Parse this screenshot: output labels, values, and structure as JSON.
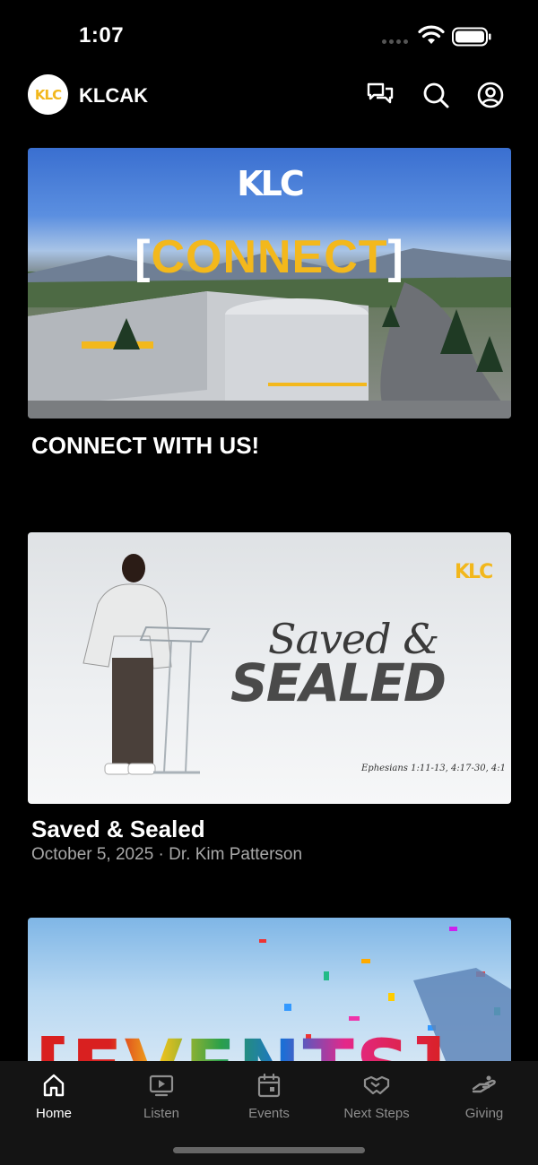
{
  "status": {
    "time": "1:07"
  },
  "header": {
    "logo_text": "KLC",
    "app_name": "KLCAK",
    "icons": [
      "chat-icon",
      "search-icon",
      "profile-icon"
    ]
  },
  "cards": [
    {
      "image": {
        "logo": "KLC",
        "bracket_left": "[",
        "word": "CONNECT",
        "bracket_right": "]"
      },
      "title": "CONNECT WITH US!"
    },
    {
      "image": {
        "logo": "KLC",
        "script": "Saved &",
        "block": "SEALED",
        "reference": "Ephesians 1:11-13, 4:17-30, 4:1"
      },
      "title": "Saved & Sealed",
      "subtitle": "October 5, 2025 · Dr. Kim Patterson"
    },
    {
      "image": {
        "word": "[EVENTS]"
      }
    }
  ],
  "tabs": [
    {
      "label": "Home",
      "icon": "home-icon",
      "active": true
    },
    {
      "label": "Listen",
      "icon": "play-screen-icon",
      "active": false
    },
    {
      "label": "Events",
      "icon": "calendar-icon",
      "active": false
    },
    {
      "label": "Next Steps",
      "icon": "handshake-icon",
      "active": false
    },
    {
      "label": "Giving",
      "icon": "giving-hand-icon",
      "active": false
    }
  ],
  "colors": {
    "accent": "#f3b81c",
    "background": "#000000",
    "tab_bar": "#141414",
    "muted_text": "#a8a8a8"
  }
}
